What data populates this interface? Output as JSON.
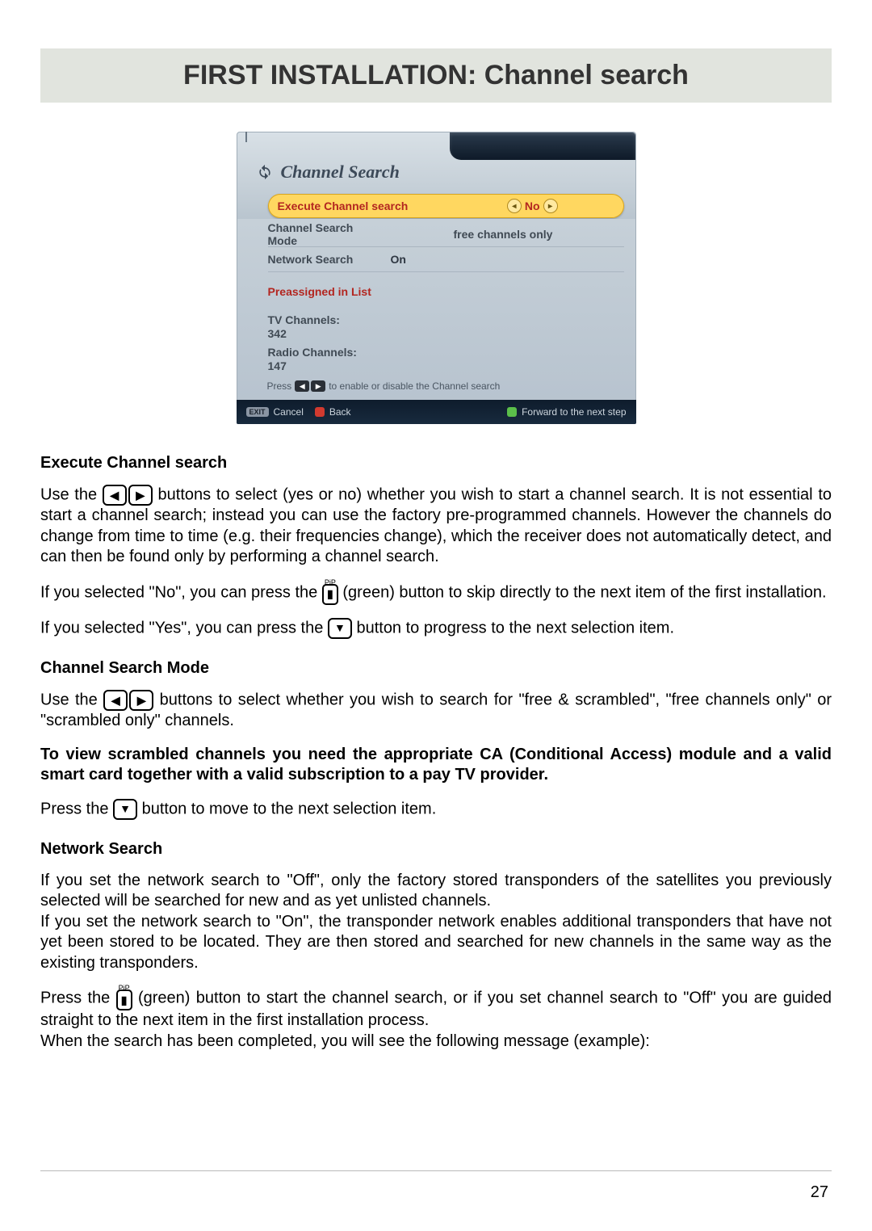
{
  "page": {
    "title": "FIRST INSTALLATION: Channel search",
    "number": "27"
  },
  "osd": {
    "window_title": "Channel Search",
    "rows": {
      "execute": {
        "label": "Execute Channel search",
        "value": "No"
      },
      "mode": {
        "label": "Channel Search Mode",
        "value": "free channels only"
      },
      "network": {
        "label": "Network Search",
        "value": "On"
      }
    },
    "preassigned_heading": "Preassigned in List",
    "tv_channels_label": "TV Channels:",
    "tv_channels_value": "342",
    "radio_channels_label": "Radio Channels:",
    "radio_channels_value": "147",
    "hint_prefix": "Press",
    "hint_suffix": "to enable or disable the Channel search",
    "footer": {
      "exit_key": "EXIT",
      "cancel": "Cancel",
      "back": "Back",
      "forward": "Forward to the next step"
    }
  },
  "sections": {
    "execute_heading": "Execute Channel search",
    "execute_p1a": "Use the ",
    "execute_p1b": " buttons to select (yes or no) whether you wish to start a channel search. It is not essential to start a channel search; instead you can use the factory pre-programmed channels. However the channels do change from time to time (e.g. their frequencies change), which the receiver does not automatically detect, and can then be found only by performing a channel search.",
    "execute_p2a": "If you selected \"No\", you can press the ",
    "execute_p2b": " (green) button to skip directly to the next item of the first installation.",
    "execute_p3a": "If you selected \"Yes\", you can press the ",
    "execute_p3b": " button to progress to the next selection item.",
    "mode_heading": "Channel Search Mode",
    "mode_p1a": "Use the ",
    "mode_p1b": " buttons to select whether you wish to search for \"free & scrambled\", \"free channels only\" or \"scrambled only\" channels.",
    "mode_note": "To view scrambled channels you need the appropriate CA (Conditional Access) module and a valid smart card together with a valid subscription to a pay TV provider.",
    "mode_p2a": "Press the ",
    "mode_p2b": " button to move to the next selection item.",
    "network_heading": "Network Search",
    "network_p1": "If you set the network search to \"Off\", only the factory stored transponders of the satellites you previously selected will be searched for new and as yet unlisted channels.",
    "network_p2": "If you set the network search to \"On\", the transponder network enables additional transponders that have not yet been stored to be located. They are then stored and searched for new channels in the same way as the existing transponders.",
    "network_p3a": "Press the ",
    "network_p3b": " (green) button to start the channel search, or if you set channel search to \"Off\" you are guided straight to the next item in the first installation process.",
    "network_p4": "When the search has been completed, you will see the following message (example):"
  }
}
